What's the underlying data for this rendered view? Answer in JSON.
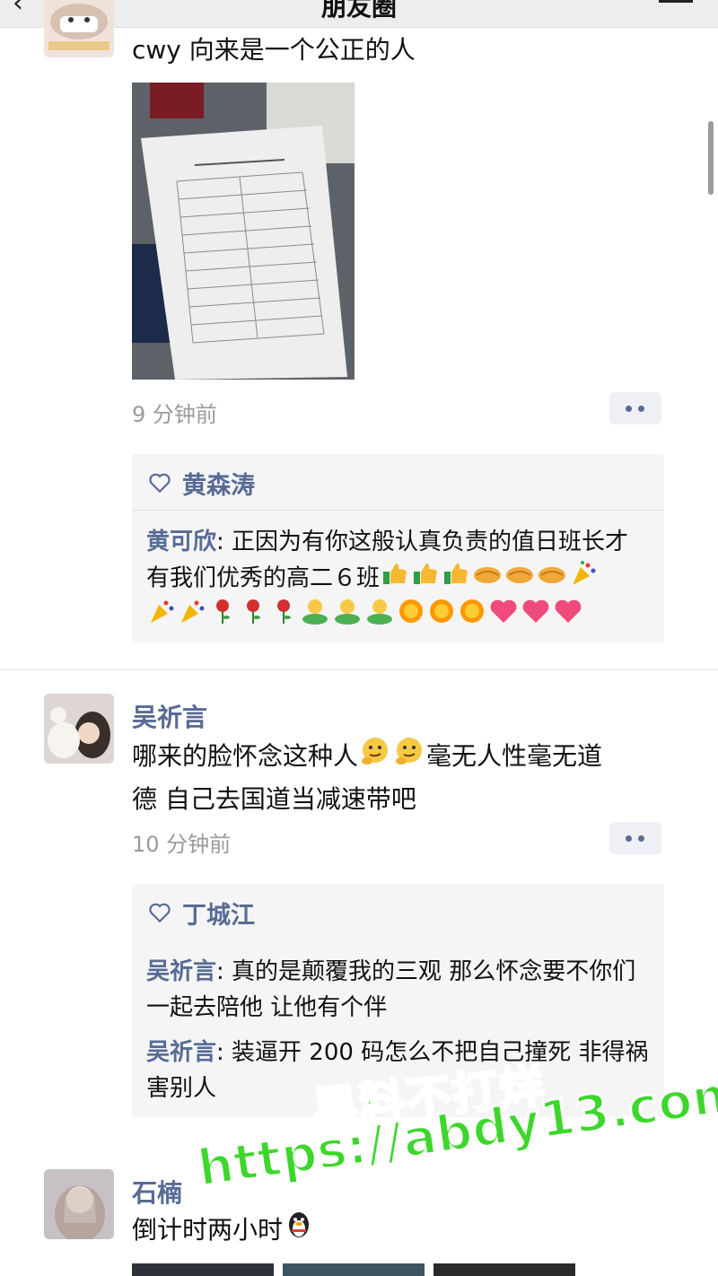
{
  "header": {
    "title": "朋友圈",
    "back_glyph": "‹",
    "menu_icon": "camera-icon"
  },
  "posts": [
    {
      "text": "cwy 向来是一个公正的人",
      "time": "9 分钟前",
      "photo_icon": "document-photo",
      "likes": "黄森涛",
      "comments": [
        {
          "author": "黄可欣",
          "sep": ": ",
          "text": "正因为有你这般认真负责的值日班长才有我们优秀的高二６班"
        }
      ]
    },
    {
      "author": "吴祈言",
      "text_line1": "哪来的脸怀念这种人",
      "text_line1b": "毫无人性毫无道",
      "text_line2": "德 自己去国道当减速带吧",
      "time": "10 分钟前",
      "likes": "丁城江",
      "comments": [
        {
          "author": "吴祈言",
          "sep": ": ",
          "text": "真的是颠覆我的三观 那么怀念要不你们一起去陪他 让他有个伴"
        },
        {
          "author": "吴祈言",
          "sep": ": ",
          "text": "装逼开 200 码怎么不把自己撞死 非得祸害别人"
        }
      ]
    },
    {
      "author": "石楠",
      "text": "倒计时两小时"
    }
  ],
  "watermark": {
    "line1": "黑料不打烊",
    "line2": "https://abdy13.com"
  },
  "colors": {
    "link": "#576b95",
    "watermark": "#3dd62c"
  }
}
